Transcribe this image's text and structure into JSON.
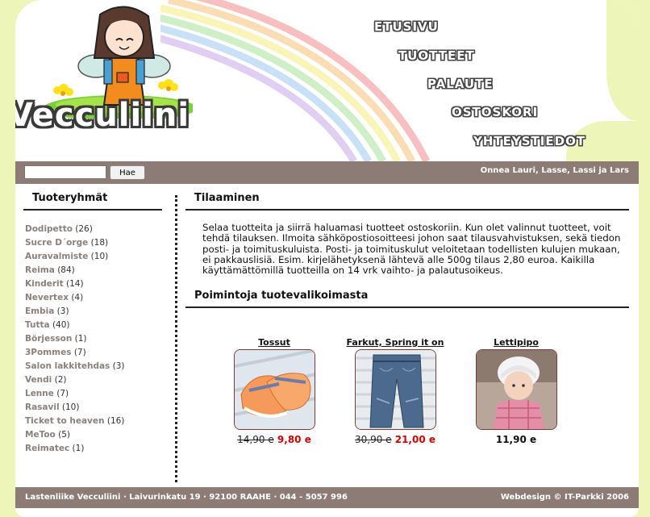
{
  "header": {
    "logo_text": "Vecculiini",
    "nav": [
      "ETUSIVU",
      "TUOTTEET",
      "PALAUTE",
      "OSTOSKORI",
      "YHTEYSTIEDOT"
    ]
  },
  "search": {
    "placeholder": "",
    "value": "",
    "button_label": "Hae"
  },
  "greeting": "Onnea Lauri, Lasse, Lassi ja Lars",
  "sidebar": {
    "title": "Tuoteryhmät",
    "categories": [
      {
        "name": "Dodipetto",
        "count": "(26)"
      },
      {
        "name": "Sucre D´orge",
        "count": "(18)"
      },
      {
        "name": "Auravalmiste",
        "count": "(10)"
      },
      {
        "name": "Reima",
        "count": "(84)"
      },
      {
        "name": "Kinderit",
        "count": "(14)"
      },
      {
        "name": "Nevertex",
        "count": "(4)"
      },
      {
        "name": "Embia",
        "count": "(3)"
      },
      {
        "name": "Tutta",
        "count": "(40)"
      },
      {
        "name": "Börjesson",
        "count": "(1)"
      },
      {
        "name": "3Pommes",
        "count": "(7)"
      },
      {
        "name": "Salon lakkitehdas",
        "count": "(3)"
      },
      {
        "name": "Vendi",
        "count": "(2)"
      },
      {
        "name": "Lenne",
        "count": "(7)"
      },
      {
        "name": "Rasavil",
        "count": "(10)"
      },
      {
        "name": "Ticket to heaven",
        "count": "(16)"
      },
      {
        "name": "MeToo",
        "count": "(5)"
      },
      {
        "name": "Reimatec",
        "count": "(1)"
      }
    ]
  },
  "main": {
    "title": "Tilaaminen",
    "text": "Selaa tuotteita ja siirrä haluamasi tuotteet ostoskoriin. Kun olet valinnut tuotteet, voit tehdä tilauksen. Ilmoita sähköpostiosoitteesi johon saat tilausvahvistuksen, sekä tiedon posti- ja toimituskuluista. Posti- ja toimituskulut veloitetaan todellisten kulujen mukaan, ei pakkauslisiä. Esim. kirjelähetyksenä lähtevä alle 500g tilaus 2,80 euroa. Kaikilla käyttämättömillä tuotteilla on 14 vrk vaihto- ja palautusoikeus.",
    "picks_title": "Poimintoja tuotevalikoimasta",
    "products": [
      {
        "name": "Tossut",
        "old_price": "14,90 e",
        "price": "9,80 e"
      },
      {
        "name": "Farkut, Spring it on",
        "old_price": "30,90 e",
        "price": "21,00 e"
      },
      {
        "name": "Lettipipo",
        "old_price": "",
        "price": "11,90 e"
      }
    ]
  },
  "footer": {
    "left": "Lastenliike Vecculiini · Laivurinkatu 19 · 92100 RAAHE · 044 - 5057 996",
    "right": "Webdesign © IT-Parkki 2006"
  },
  "colors": {
    "background": "#eef5b8",
    "bar": "#8d7b76",
    "sale_price": "#d40000",
    "category_link": "#8a817d"
  }
}
